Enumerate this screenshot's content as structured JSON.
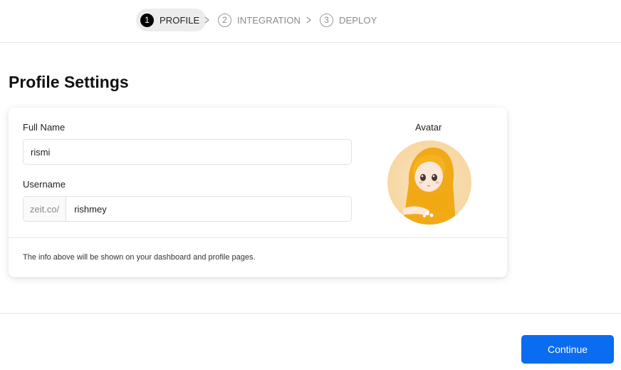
{
  "stepper": {
    "steps": [
      {
        "number": "1",
        "label": "PROFILE",
        "active": true
      },
      {
        "number": "2",
        "label": "INTEGRATION",
        "active": false
      },
      {
        "number": "3",
        "label": "DEPLOY",
        "active": false
      }
    ]
  },
  "page": {
    "title": "Profile Settings"
  },
  "form": {
    "full_name_label": "Full Name",
    "full_name_value": "rismi",
    "username_label": "Username",
    "username_prefix": "zeit.co/",
    "username_value": "rishmey",
    "avatar_label": "Avatar",
    "note": "The info above will be shown on your dashboard and profile pages."
  },
  "actions": {
    "continue_label": "Continue"
  },
  "colors": {
    "accent": "#0a6cf0",
    "active_step_bg": "#ececec"
  }
}
